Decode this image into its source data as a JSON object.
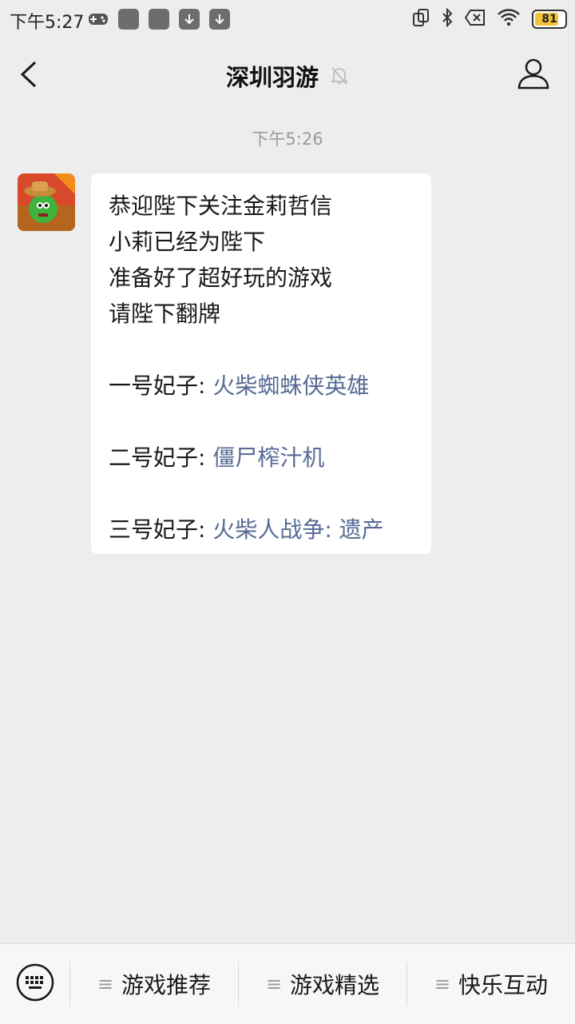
{
  "status_bar": {
    "time": "下午5:27",
    "battery": "81"
  },
  "nav": {
    "title": "深圳羽游"
  },
  "chat": {
    "timestamp": "下午5:26",
    "message": {
      "lines": [
        "恭迎陛下关注金莉哲信",
        "小莉已经为陛下",
        "准备好了超好玩的游戏",
        "请陛下翻牌"
      ],
      "items": [
        {
          "label": "一号妃子: ",
          "game": "火柴蜘蛛侠英雄"
        },
        {
          "label": "二号妃子: ",
          "game": "僵尸榨汁机"
        },
        {
          "label": "三号妃子: ",
          "game": "火柴人战争: 遗产"
        }
      ]
    }
  },
  "menu": {
    "items": [
      {
        "label": "游戏推荐"
      },
      {
        "label": "游戏精选"
      },
      {
        "label": "快乐互动"
      }
    ]
  },
  "colors": {
    "link": "#576b95",
    "background": "#ededed"
  }
}
